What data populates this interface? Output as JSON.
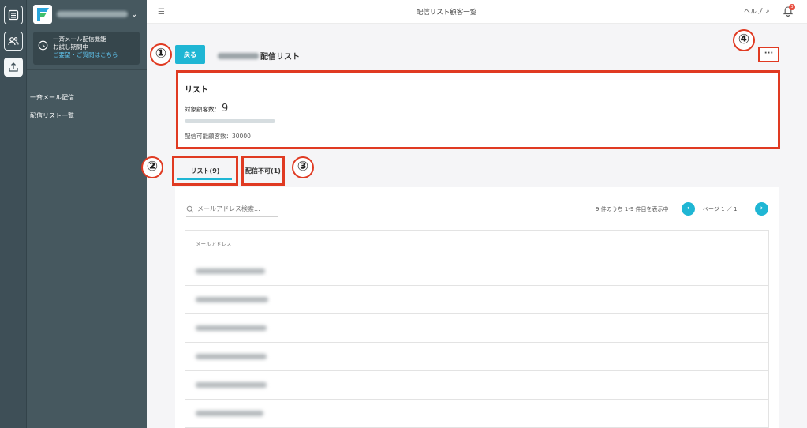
{
  "app": {
    "title": "配信リスト顧客一覧"
  },
  "colors": {
    "accent": "#1fb6d4",
    "annotation": "#e03a22",
    "sidebar": "#46585f",
    "rail": "#3e4f57"
  },
  "rail": [
    {
      "icon": "calendar-list-icon"
    },
    {
      "icon": "users-icon"
    },
    {
      "icon": "upload-tray-icon",
      "active": true
    }
  ],
  "sidebar": {
    "trial_line1": "一斉メール配信機能",
    "trial_line2": "お試し期間中",
    "trial_link": "ご要望・ご質問はこちら",
    "items": [
      {
        "label": "一斉メール配信"
      },
      {
        "label": "配信リスト一覧"
      }
    ]
  },
  "topbar": {
    "title": "配信リスト顧客一覧",
    "help": "ヘルプ",
    "notification_count": "3"
  },
  "header": {
    "back_label": "戻る",
    "list_name_suffix": "配信リスト",
    "more_label": "···"
  },
  "summary": {
    "title": "リスト",
    "count_label": "対象顧客数：",
    "count": "9",
    "usage_fraction": 0.0003,
    "limit_text": "配信可能顧客数：30000"
  },
  "tabs": [
    {
      "label": "リスト(9)",
      "active": true
    },
    {
      "label": "配信不可(1)"
    }
  ],
  "callouts": [
    "①",
    "②",
    "③",
    "④"
  ],
  "search": {
    "placeholder": "メールアドレス検索..."
  },
  "pager": {
    "info": "9 件のうち 1-9 件目を表示中",
    "prev": "‹",
    "page": "ページ 1 ／ 1",
    "next": "›"
  },
  "table": {
    "column": "メールアドレス",
    "row_count": 6
  }
}
